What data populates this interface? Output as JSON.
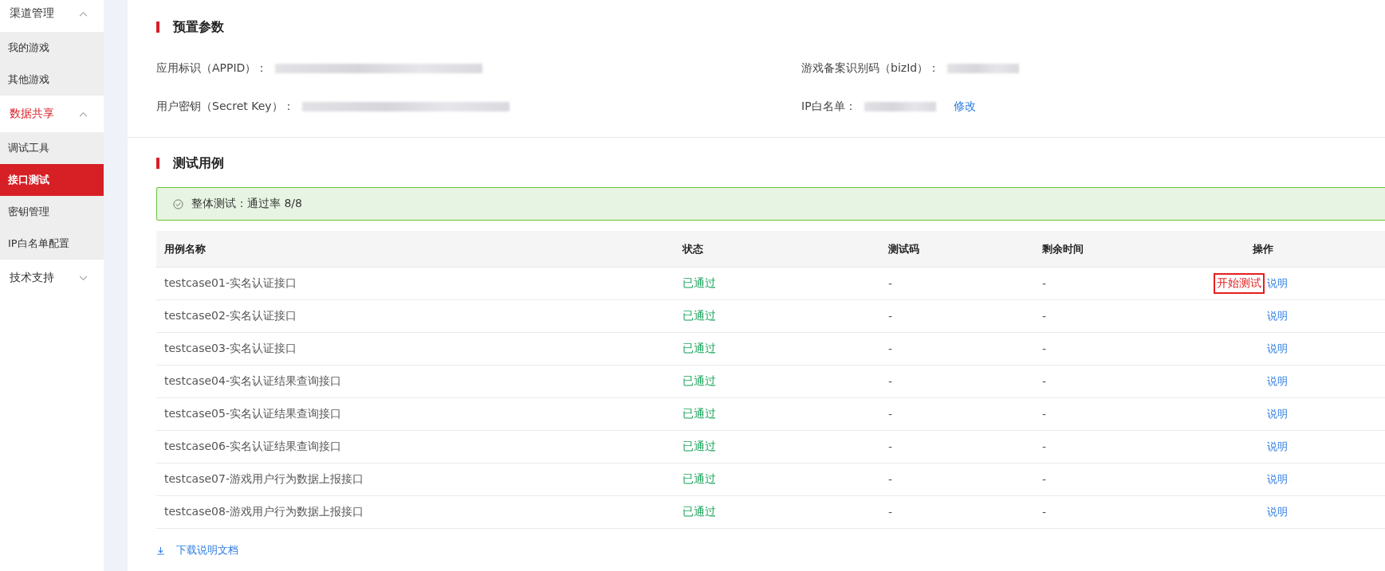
{
  "sidebar": {
    "groups": [
      {
        "label": "渠道管理",
        "expanded": true,
        "active": false,
        "items": [
          {
            "label": "我的游戏",
            "selected": false
          },
          {
            "label": "其他游戏",
            "selected": false
          }
        ]
      },
      {
        "label": "数据共享",
        "expanded": true,
        "active": true,
        "items": [
          {
            "label": "调试工具",
            "selected": false
          },
          {
            "label": "接口测试",
            "selected": true
          },
          {
            "label": "密钥管理",
            "selected": false
          },
          {
            "label": "IP白名单配置",
            "selected": false
          }
        ]
      },
      {
        "label": "技术支持",
        "expanded": false,
        "active": false
      }
    ]
  },
  "preset_params": {
    "title": "预置参数",
    "left_fields": [
      {
        "label": "应用标识（APPID）："
      },
      {
        "label": "用户密钥（Secret Key）："
      }
    ],
    "right_fields": [
      {
        "label": "游戏备案识别码（bizId）："
      },
      {
        "label": "IP白名单：",
        "action": "修改"
      }
    ]
  },
  "test_cases": {
    "title": "测试用例",
    "summary": "整体测试：通过率 8/8",
    "columns": [
      "用例名称",
      "状态",
      "测试码",
      "剩余时间",
      "操作"
    ],
    "rows": [
      {
        "name": "testcase01-实名认证接口",
        "status": "已通过",
        "test_code": "-",
        "remaining": "-",
        "actions": [
          {
            "label": "开始测试",
            "highlighted": true
          },
          {
            "label": "说明",
            "highlighted": false
          }
        ]
      },
      {
        "name": "testcase02-实名认证接口",
        "status": "已通过",
        "test_code": "-",
        "remaining": "-",
        "actions": [
          {
            "label": "说明",
            "highlighted": false
          }
        ]
      },
      {
        "name": "testcase03-实名认证接口",
        "status": "已通过",
        "test_code": "-",
        "remaining": "-",
        "actions": [
          {
            "label": "说明",
            "highlighted": false
          }
        ]
      },
      {
        "name": "testcase04-实名认证结果查询接口",
        "status": "已通过",
        "test_code": "-",
        "remaining": "-",
        "actions": [
          {
            "label": "说明",
            "highlighted": false
          }
        ]
      },
      {
        "name": "testcase05-实名认证结果查询接口",
        "status": "已通过",
        "test_code": "-",
        "remaining": "-",
        "actions": [
          {
            "label": "说明",
            "highlighted": false
          }
        ]
      },
      {
        "name": "testcase06-实名认证结果查询接口",
        "status": "已通过",
        "test_code": "-",
        "remaining": "-",
        "actions": [
          {
            "label": "说明",
            "highlighted": false
          }
        ]
      },
      {
        "name": "testcase07-游戏用户行为数据上报接口",
        "status": "已通过",
        "test_code": "-",
        "remaining": "-",
        "actions": [
          {
            "label": "说明",
            "highlighted": false
          }
        ]
      },
      {
        "name": "testcase08-游戏用户行为数据上报接口",
        "status": "已通过",
        "test_code": "-",
        "remaining": "-",
        "actions": [
          {
            "label": "说明",
            "highlighted": false
          }
        ]
      }
    ],
    "download": "下载说明文档"
  }
}
